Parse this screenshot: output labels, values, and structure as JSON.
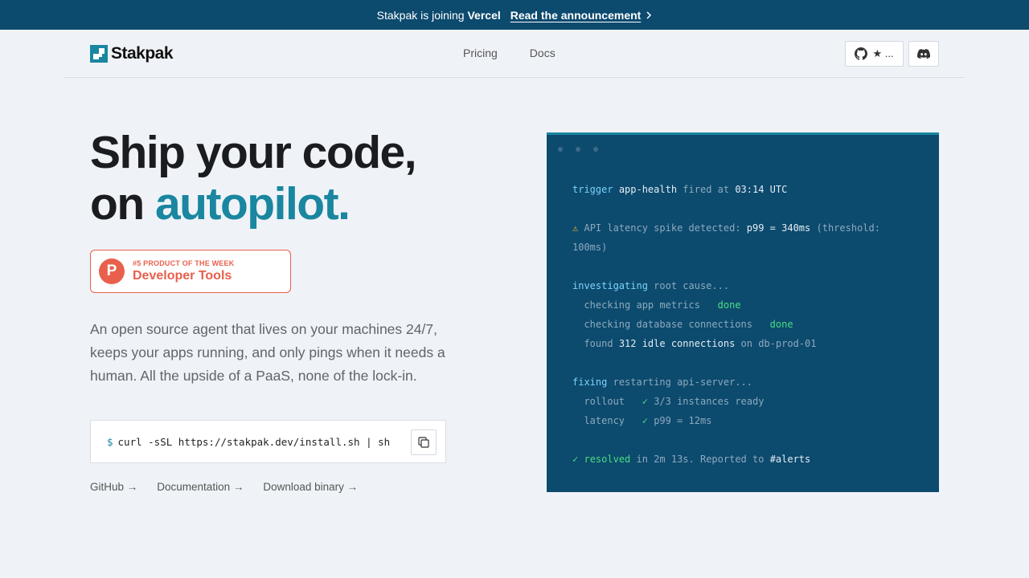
{
  "banner": {
    "text_pre": "Stakpak is joining",
    "text_strong": "Vercel",
    "link": "Read the announcement"
  },
  "nav": {
    "logo": "Stakpak",
    "links": [
      "Pricing",
      "Docs"
    ],
    "github_stars": "★ ..."
  },
  "hero": {
    "title_line1": "Ship your code,",
    "title_line2_pre": "on ",
    "title_line2_accent": "autopilot."
  },
  "badge": {
    "letter": "P",
    "small": "#5 PRODUCT OF THE WEEK",
    "big": "Developer Tools"
  },
  "description": "An open source agent that lives on your machines 24/7, keeps your apps running, and only pings when it needs a human. All the upside of a PaaS, none of the lock-in.",
  "install": {
    "prompt": "$",
    "command": "curl -sSL https://stakpak.dev/install.sh | sh"
  },
  "links": [
    "GitHub →",
    "Documentation →",
    "Download binary →"
  ],
  "terminal": {
    "l1": {
      "kw": "trigger",
      "name": "app-health",
      "mid": "fired at",
      "time": "03:14 UTC"
    },
    "l2": {
      "icon": "⚠",
      "pre": "API latency spike detected:",
      "val": "p99 = 340ms",
      "post": "(threshold:"
    },
    "l2b": "100ms)",
    "l3": {
      "kw": "investigating",
      "rest": "root cause..."
    },
    "l4": {
      "text": "checking app metrics",
      "status": "done"
    },
    "l5": {
      "text": "checking database connections",
      "status": "done"
    },
    "l6": {
      "pre": "found",
      "val": "312 idle connections",
      "post": "on db-prod-01"
    },
    "l7": {
      "kw": "fixing",
      "rest": "restarting api-server..."
    },
    "l8": {
      "label": "rollout",
      "check": "✓",
      "val": "3/3 instances ready"
    },
    "l9": {
      "label": "latency",
      "check": "✓",
      "val": "p99 = 12ms"
    },
    "l10": {
      "check": "✓",
      "kw": "resolved",
      "mid": "in 2m 13s. Reported to",
      "channel": "#alerts"
    }
  },
  "colors": {
    "accent": "#1a86a0",
    "banner": "#0c4a6e",
    "product_hunt": "#e8604c",
    "terminal_bg": "#0c4a6e"
  }
}
